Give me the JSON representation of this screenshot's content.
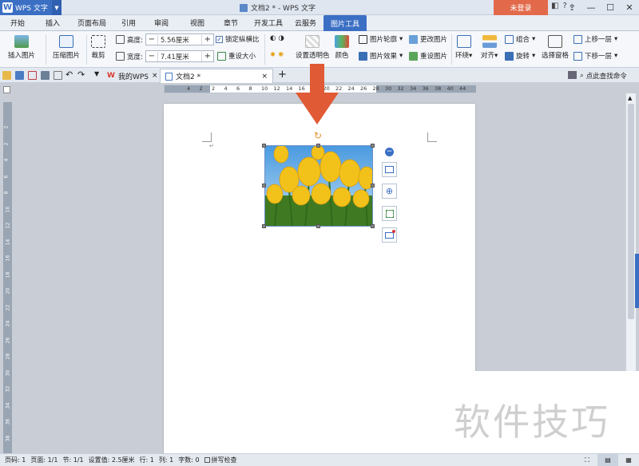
{
  "titlebar": {
    "app_name": "WPS 文字",
    "document_title": "文档2 * - WPS 文字",
    "login_label": "未登录"
  },
  "menu": {
    "tabs": [
      "开始",
      "插入",
      "页面布局",
      "引用",
      "审阅",
      "视图",
      "章节",
      "开发工具",
      "云服务",
      "图片工具"
    ],
    "active_tab": "图片工具"
  },
  "ribbon": {
    "insert_picture": "插入图片",
    "compress_picture": "压缩图片",
    "crop": "裁剪",
    "height_label": "高度:",
    "height_value": "5.56厘米",
    "width_label": "宽度:",
    "width_value": "7.41厘米",
    "lock_ratio": "锁定纵横比",
    "reset_size": "重设大小",
    "set_transparent": "设置透明色",
    "color": "颜色",
    "picture_outline": "图片轮廓",
    "picture_effect": "图片效果",
    "change_picture": "更改图片",
    "reset_picture": "重设图片",
    "wrap": "环绕",
    "align": "对齐",
    "group": "组合",
    "rotate": "旋转",
    "selection_pane": "选择窗格",
    "bring_forward": "上移一层",
    "send_backward": "下移一层"
  },
  "doctabs": {
    "my_wps": "我的WPS",
    "doc": "文档2 *",
    "find_command": "点此查找命令"
  },
  "ruler": {
    "h_numbers": [
      "4",
      "2",
      "2",
      "4",
      "6",
      "8",
      "10",
      "12",
      "14",
      "16",
      "18",
      "20",
      "22",
      "24",
      "26",
      "28",
      "30",
      "32",
      "34",
      "36",
      "38",
      "40",
      "44"
    ],
    "v_numbers": [
      "2",
      "2",
      "4",
      "6",
      "8",
      "10",
      "12",
      "14",
      "16",
      "18",
      "20",
      "22",
      "24",
      "26",
      "28",
      "30",
      "32",
      "34",
      "36",
      "38"
    ]
  },
  "status": {
    "page_num": "页码: 1",
    "pages": "页面: 1/1",
    "section": "节: 1/1",
    "setting_value": "设置值: 2.5厘米",
    "row": "行: 1",
    "column": "列: 1",
    "word_count": "字数: 0",
    "spell_check": "拼写检查"
  },
  "watermark": "软件技巧",
  "colors": {
    "accent": "#3b6fc4",
    "login": "#e2694a",
    "arrow": "#e05a35"
  }
}
